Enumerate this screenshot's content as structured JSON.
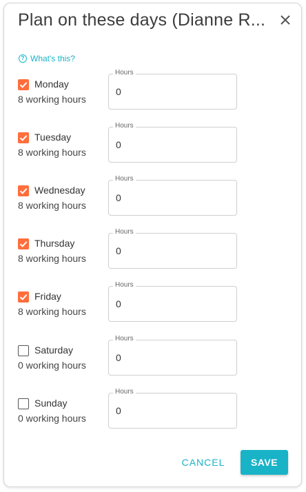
{
  "dialog": {
    "title": "Plan on these days (Dianne R...",
    "help_label": "What's this?",
    "close_icon": "close-icon",
    "help_icon": "question-circle-icon"
  },
  "days": [
    {
      "name": "Monday",
      "hours_text": "8 working hours",
      "checked": true,
      "field_label": "Hours",
      "value": "0"
    },
    {
      "name": "Tuesday",
      "hours_text": "8 working hours",
      "checked": true,
      "field_label": "Hours",
      "value": "0"
    },
    {
      "name": "Wednesday",
      "hours_text": "8 working hours",
      "checked": true,
      "field_label": "Hours",
      "value": "0"
    },
    {
      "name": "Thursday",
      "hours_text": "8 working hours",
      "checked": true,
      "field_label": "Hours",
      "value": "0"
    },
    {
      "name": "Friday",
      "hours_text": "8 working hours",
      "checked": true,
      "field_label": "Hours",
      "value": "0"
    },
    {
      "name": "Saturday",
      "hours_text": "0 working hours",
      "checked": false,
      "field_label": "Hours",
      "value": "0"
    },
    {
      "name": "Sunday",
      "hours_text": "0 working hours",
      "checked": false,
      "field_label": "Hours",
      "value": "0"
    }
  ],
  "actions": {
    "cancel_label": "CANCEL",
    "save_label": "SAVE"
  },
  "colors": {
    "accent": "#19b3c8",
    "checkbox_checked": "#ff6e3c"
  }
}
